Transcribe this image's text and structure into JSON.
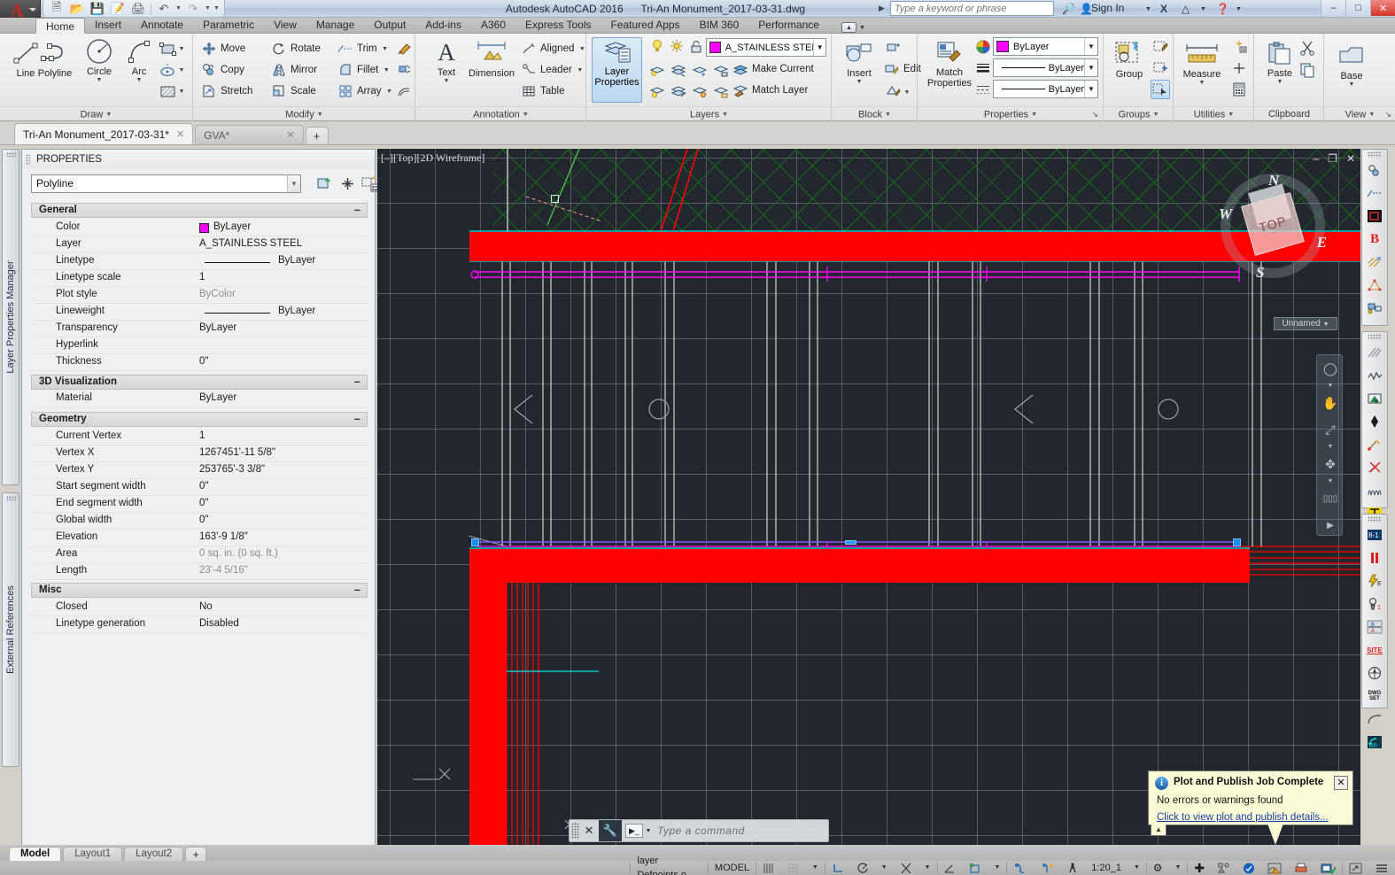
{
  "window": {
    "app_title": "Autodesk AutoCAD 2016",
    "document_title": "Tri-An Monument_2017-03-31.dwg",
    "sign_in": "Sign In",
    "search_placeholder": "Type a keyword or phrase",
    "minimize": "–",
    "maximize": "□",
    "close": "✕"
  },
  "ribbon": {
    "tabs": [
      {
        "label": "Home",
        "active": true
      },
      {
        "label": "Insert",
        "active": false
      },
      {
        "label": "Annotate",
        "active": false
      },
      {
        "label": "Parametric",
        "active": false
      },
      {
        "label": "View",
        "active": false
      },
      {
        "label": "Manage",
        "active": false
      },
      {
        "label": "Output",
        "active": false
      },
      {
        "label": "Add-ins",
        "active": false
      },
      {
        "label": "A360",
        "active": false
      },
      {
        "label": "Express Tools",
        "active": false
      },
      {
        "label": "Featured Apps",
        "active": false
      },
      {
        "label": "BIM 360",
        "active": false
      },
      {
        "label": "Performance",
        "active": false
      }
    ],
    "panels": {
      "draw": {
        "title": "Draw",
        "line": "Line",
        "polyline": "Polyline",
        "circle": "Circle",
        "arc": "Arc"
      },
      "modify": {
        "title": "Modify",
        "move": "Move",
        "rotate": "Rotate",
        "trim": "Trim",
        "copy": "Copy",
        "mirror": "Mirror",
        "fillet": "Fillet",
        "stretch": "Stretch",
        "scale": "Scale",
        "array": "Array"
      },
      "annotation": {
        "title": "Annotation",
        "text": "Text",
        "dimension": "Dimension",
        "aligned": "Aligned",
        "leader": "Leader",
        "table": "Table"
      },
      "layers": {
        "title": "Layers",
        "layer_properties": "Layer Properties",
        "current_layer": "A_STAINLESS STEEL",
        "current_layer_color": "#ff00ff",
        "make_current": "Make Current",
        "match_layer": "Match Layer"
      },
      "block": {
        "title": "Block",
        "insert": "Insert",
        "edit": "Edit"
      },
      "properties": {
        "title": "Properties",
        "match_properties": "Match Properties",
        "color_value": "ByLayer",
        "color_swatch": "#ff00ff",
        "linewidth_value": "ByLayer",
        "linetype_value": "ByLayer"
      },
      "groups": {
        "title": "Groups",
        "group": "Group"
      },
      "utilities": {
        "title": "Utilities",
        "measure": "Measure"
      },
      "clipboard": {
        "title": "Clipboard",
        "paste": "Paste"
      },
      "view": {
        "title": "View",
        "base": "Base"
      }
    }
  },
  "document_tabs": [
    {
      "label": "Tri-An Monument_2017-03-31*",
      "active": true,
      "close": "✕"
    },
    {
      "label": "GVA*",
      "active": false,
      "close": "✕"
    }
  ],
  "document_tab_add": "+",
  "left_docks": [
    {
      "label": "Layer Properties Manager"
    },
    {
      "label": "External References"
    }
  ],
  "properties_palette": {
    "title": "PROPERTIES",
    "object_type": "Polyline",
    "groups": [
      {
        "name": "General",
        "collapse": "–",
        "rows": [
          {
            "key": "Color",
            "value": "ByLayer",
            "type": "color",
            "swatch": "#ff00ff"
          },
          {
            "key": "Layer",
            "value": "A_STAINLESS STEEL",
            "type": "text"
          },
          {
            "key": "Linetype",
            "value": "ByLayer",
            "type": "linetype"
          },
          {
            "key": "Linetype scale",
            "value": "1",
            "type": "text"
          },
          {
            "key": "Plot style",
            "value": "ByColor",
            "type": "gray"
          },
          {
            "key": "Lineweight",
            "value": "ByLayer",
            "type": "linetype"
          },
          {
            "key": "Transparency",
            "value": "ByLayer",
            "type": "text"
          },
          {
            "key": "Hyperlink",
            "value": "",
            "type": "text"
          },
          {
            "key": "Thickness",
            "value": "0\"",
            "type": "text"
          }
        ]
      },
      {
        "name": "3D Visualization",
        "collapse": "–",
        "rows": [
          {
            "key": "Material",
            "value": "ByLayer",
            "type": "text"
          }
        ]
      },
      {
        "name": "Geometry",
        "collapse": "–",
        "rows": [
          {
            "key": "Current Vertex",
            "value": "1",
            "type": "text"
          },
          {
            "key": "Vertex X",
            "value": "1267451'-11 5/8\"",
            "type": "text"
          },
          {
            "key": "Vertex Y",
            "value": "253765'-3 3/8\"",
            "type": "text"
          },
          {
            "key": "Start segment width",
            "value": "0\"",
            "type": "text"
          },
          {
            "key": "End segment width",
            "value": "0\"",
            "type": "text"
          },
          {
            "key": "Global width",
            "value": "0\"",
            "type": "text"
          },
          {
            "key": "Elevation",
            "value": "163'-9 1/8\"",
            "type": "text"
          },
          {
            "key": "Area",
            "value": "0 sq. in. (0 sq. ft.)",
            "type": "gray"
          },
          {
            "key": "Length",
            "value": "23'-4 5/16\"",
            "type": "gray"
          }
        ]
      },
      {
        "name": "Misc",
        "collapse": "–",
        "rows": [
          {
            "key": "Closed",
            "value": "No",
            "type": "text"
          },
          {
            "key": "Linetype generation",
            "value": "Disabled",
            "type": "text"
          }
        ]
      }
    ]
  },
  "viewport": {
    "label": "[–][Top][2D Wireframe]",
    "minimize": "–",
    "maximize": "❐",
    "close": "✕",
    "viewcube": {
      "top": "TOP",
      "n": "N",
      "s": "S",
      "e": "E",
      "w": "W"
    },
    "named_view": "Unnamed"
  },
  "command_line": {
    "placeholder": "Type a command",
    "close": "✕",
    "prompt": "▶_"
  },
  "layout_tabs": [
    {
      "label": "Model",
      "active": true
    },
    {
      "label": "Layout1",
      "active": false
    },
    {
      "label": "Layout2",
      "active": false
    }
  ],
  "layout_tab_add": "+",
  "status_bar": {
    "layer_info": "layer Defpoints o",
    "space": "MODEL",
    "annotation_scale": "1:20_1"
  },
  "notification": {
    "title": "Plot and Publish Job Complete",
    "message": "No errors or warnings found",
    "link": "Click to view plot and publish details...",
    "close": "✕",
    "collapse": "▲",
    "info": "i"
  }
}
